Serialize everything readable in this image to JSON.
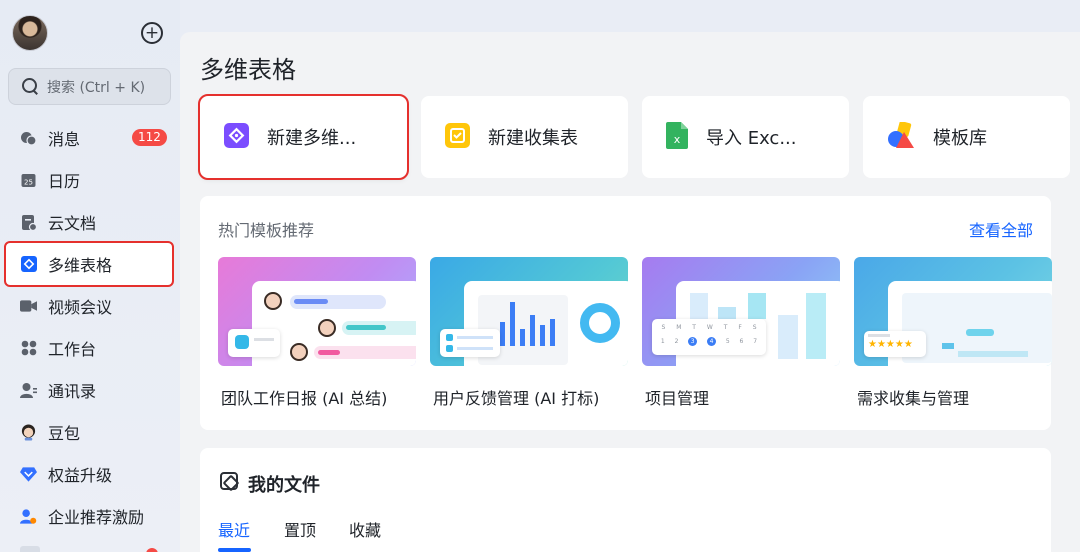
{
  "sidebar": {
    "search_placeholder": "搜索 (Ctrl + K)",
    "items": [
      {
        "label": "消息",
        "icon": "chat-bubbles-icon",
        "badge": "112"
      },
      {
        "label": "日历",
        "icon": "calendar-icon",
        "calendar_day": "25"
      },
      {
        "label": "云文档",
        "icon": "cloud-doc-icon"
      },
      {
        "label": "多维表格",
        "icon": "base-table-icon",
        "active": true
      },
      {
        "label": "视频会议",
        "icon": "video-camera-icon"
      },
      {
        "label": "工作台",
        "icon": "workplace-grid-icon"
      },
      {
        "label": "通讯录",
        "icon": "contacts-icon"
      },
      {
        "label": "豆包",
        "icon": "doubao-avatar-icon"
      },
      {
        "label": "权益升级",
        "icon": "diamond-icon"
      },
      {
        "label": "企业推荐激励",
        "icon": "referral-person-icon"
      }
    ]
  },
  "main": {
    "title": "多维表格",
    "actions": [
      {
        "label": "新建多维...",
        "icon": "new-base-icon",
        "color": "#7b4dff",
        "highlighted": true
      },
      {
        "label": "新建收集表",
        "icon": "new-form-icon",
        "color": "#ffc60a"
      },
      {
        "label": "导入 Exc...",
        "icon": "excel-icon",
        "color": "#33b35f"
      },
      {
        "label": "模板库",
        "icon": "template-library-icon",
        "color": "#ff4d4f"
      }
    ],
    "hot_templates": {
      "title": "热门模板推荐",
      "more": "查看全部",
      "items": [
        {
          "name": "团队工作日报 (AI 总结)",
          "thumb": "daily-report"
        },
        {
          "name": "用户反馈管理 (AI 打标)",
          "thumb": "feedback"
        },
        {
          "name": "项目管理",
          "thumb": "project"
        },
        {
          "name": "需求收集与管理",
          "thumb": "requirements"
        }
      ],
      "calendar_days_header": [
        "S",
        "M",
        "T",
        "W",
        "T",
        "F",
        "S"
      ],
      "calendar_days": [
        "1",
        "2",
        "3",
        "4",
        "5",
        "6",
        "7"
      ]
    },
    "my_files": {
      "title": "我的文件",
      "tabs": [
        "最近",
        "置顶",
        "收藏"
      ],
      "active_tab": "最近"
    }
  },
  "colors": {
    "accent": "#1664ff",
    "highlight_border": "#e5302d",
    "badge": "#f54a45"
  }
}
